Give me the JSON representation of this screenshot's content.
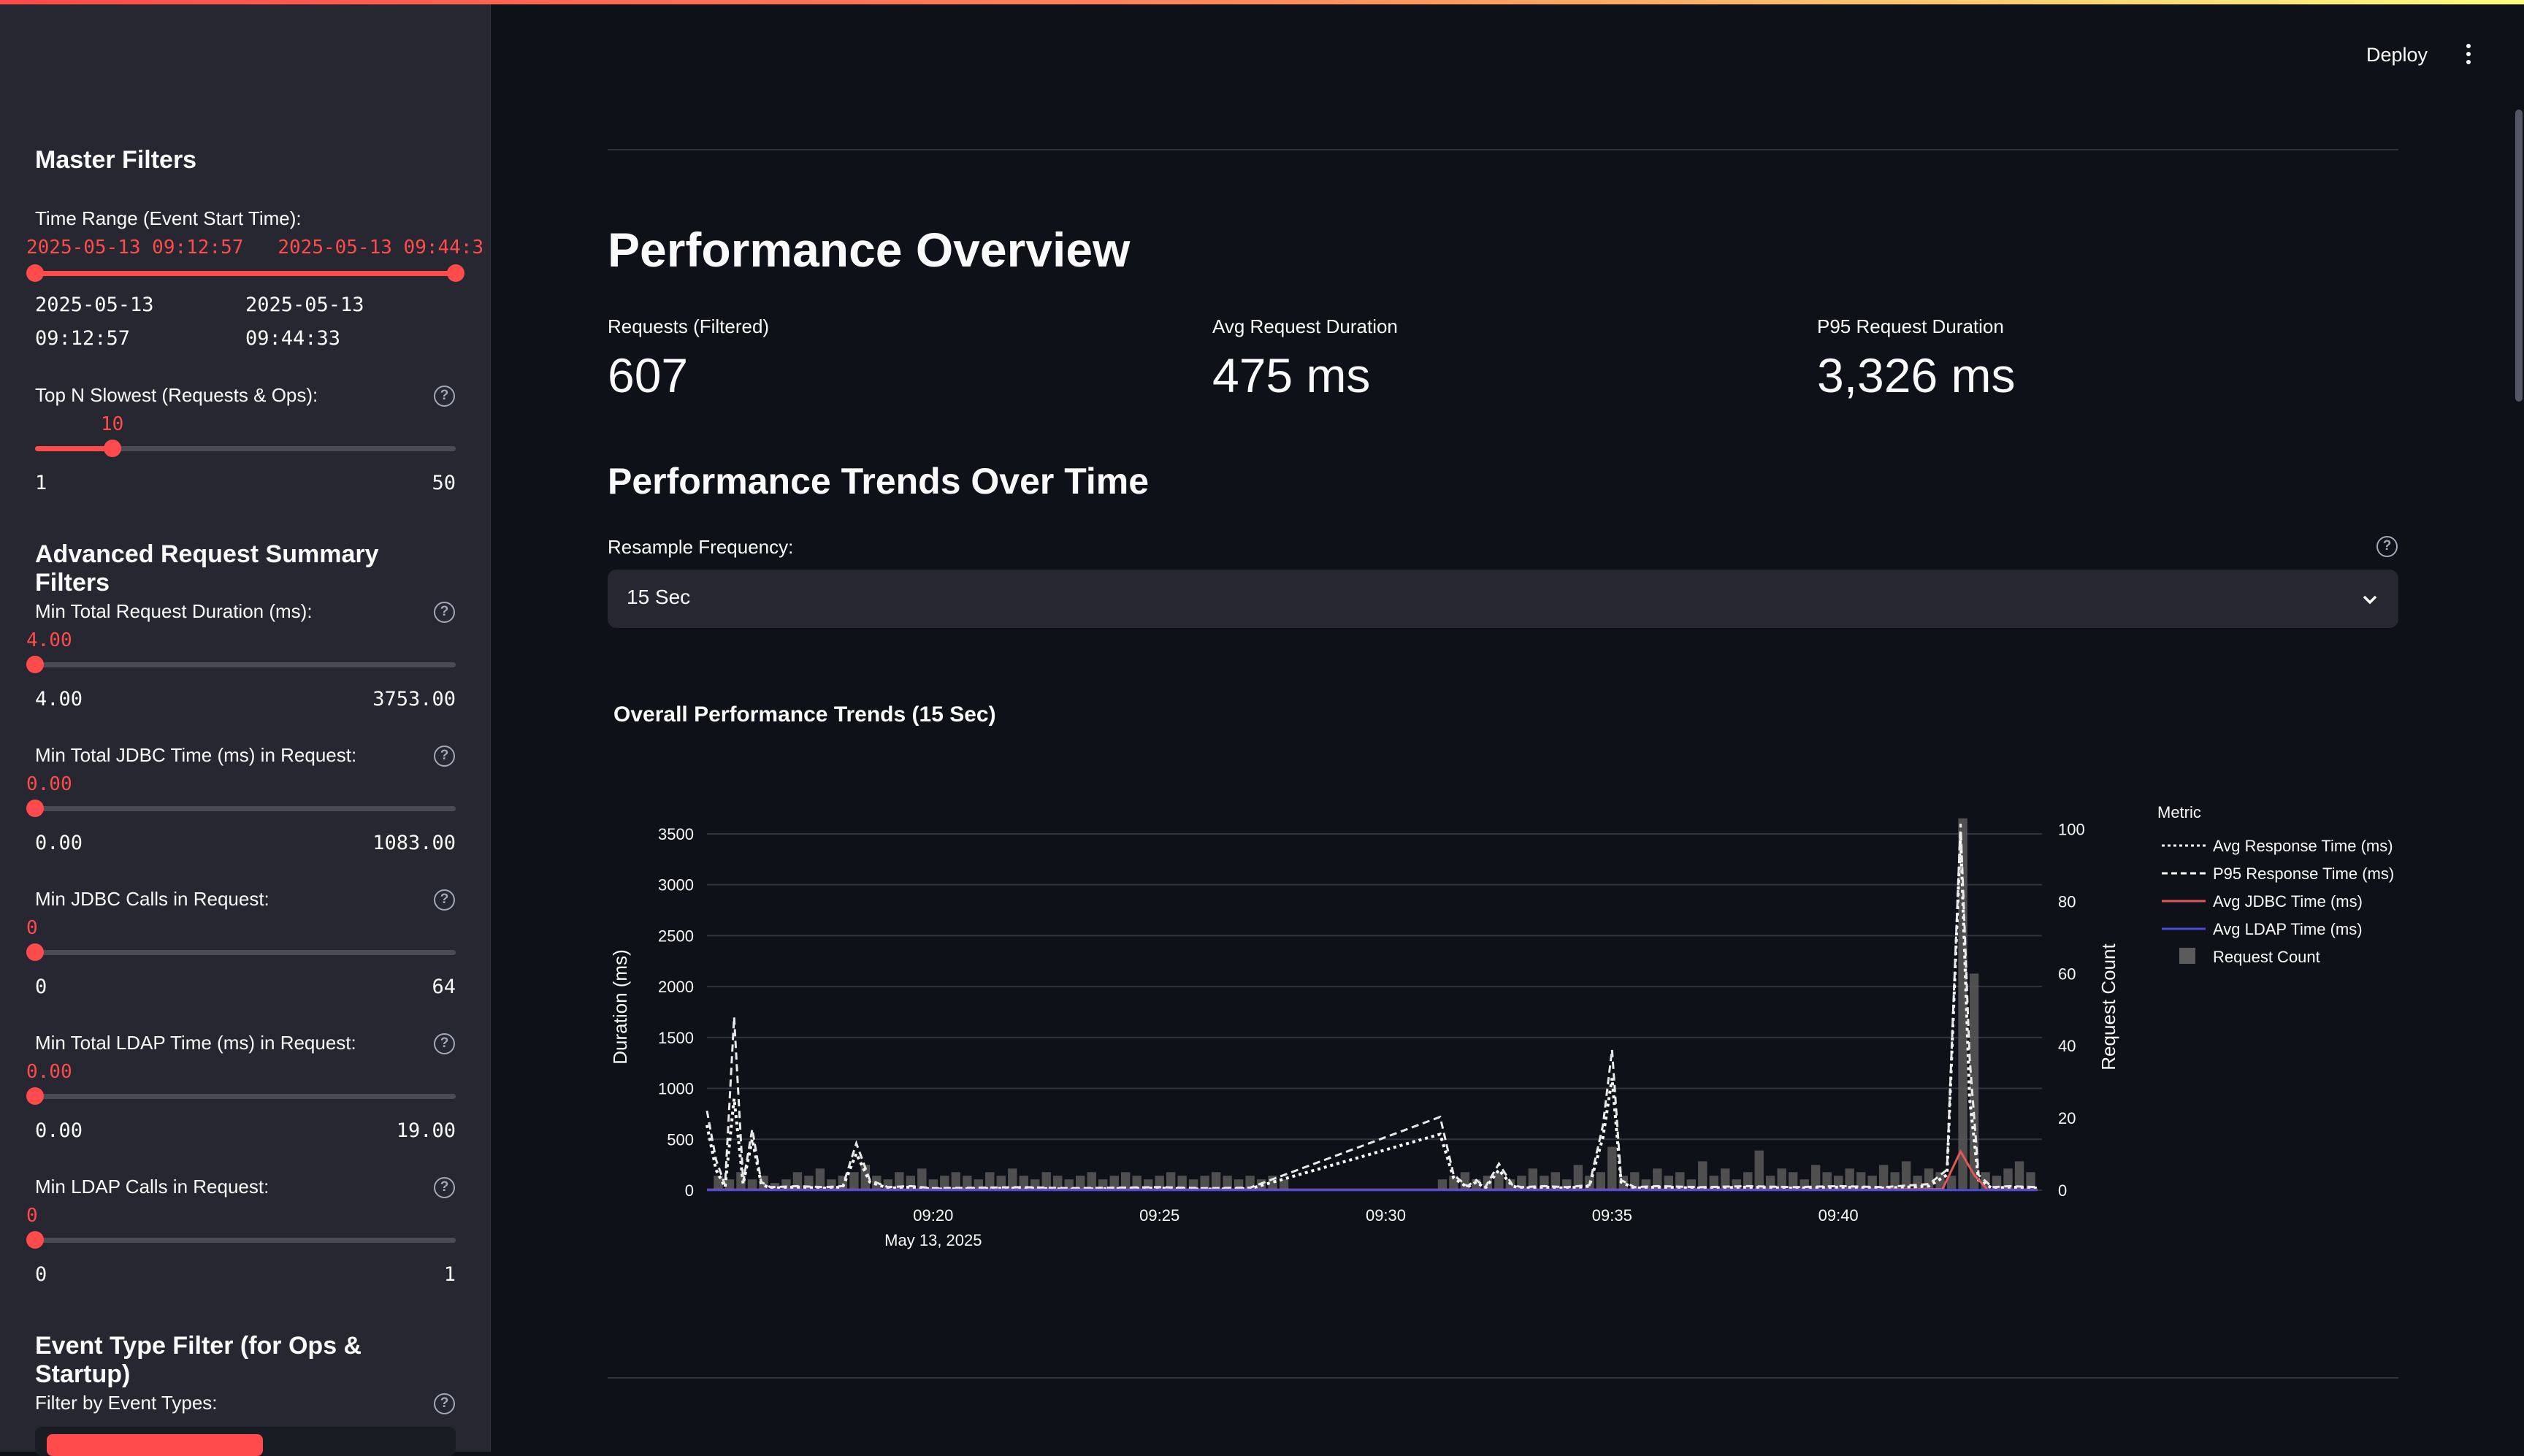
{
  "sidebar": {
    "master_filters_title": "Master Filters",
    "time_range": {
      "label": "Time Range (Event Start Time):",
      "value_display": "2025-05-13 09:12:57   2025-05-13 09:44:33",
      "min_date": "2025-05-13",
      "min_time": "09:12:57",
      "max_date": "2025-05-13",
      "max_time": "09:44:33"
    },
    "top_n": {
      "label": "Top N Slowest (Requests & Ops):",
      "value": "10",
      "min": "1",
      "max": "50",
      "fraction": 0.184
    },
    "advanced_title": "Advanced Request Summary Filters",
    "min_total_duration": {
      "label": "Min Total Request Duration (ms):",
      "value": "4.00",
      "min": "4.00",
      "max": "3753.00"
    },
    "min_jdbc_time": {
      "label": "Min Total JDBC Time (ms) in Request:",
      "value": "0.00",
      "min": "0.00",
      "max": "1083.00"
    },
    "min_jdbc_calls": {
      "label": "Min JDBC Calls in Request:",
      "value": "0",
      "min": "0",
      "max": "64"
    },
    "min_ldap_time": {
      "label": "Min Total LDAP Time (ms) in Request:",
      "value": "0.00",
      "min": "0.00",
      "max": "19.00"
    },
    "min_ldap_calls": {
      "label": "Min LDAP Calls in Request:",
      "value": "0",
      "min": "0",
      "max": "1"
    },
    "event_type_title": "Event Type Filter (for Ops & Startup)",
    "event_type_label": "Filter by Event Types:"
  },
  "header": {
    "deploy_label": "Deploy"
  },
  "main": {
    "title": "Performance Overview",
    "metrics": [
      {
        "label": "Requests (Filtered)",
        "value": "607"
      },
      {
        "label": "Avg Request Duration",
        "value": "475 ms"
      },
      {
        "label": "P95 Request Duration",
        "value": "3,326 ms"
      }
    ],
    "trends_title": "Performance Trends Over Time",
    "resample_label": "Resample Frequency:",
    "resample_value": "15 Sec"
  },
  "chart_data": {
    "type": "line",
    "title": "Overall Performance Trends (15 Sec)",
    "xlabel": "",
    "ylabel": "Duration (ms)",
    "y2label": "Request Count",
    "ylim": [
      0,
      3600
    ],
    "y2lim": [
      0,
      100
    ],
    "yticks": [
      "0",
      "500",
      "1000",
      "1500",
      "2000",
      "2500",
      "3000",
      "3500"
    ],
    "y2ticks": [
      "0",
      "20",
      "40",
      "60",
      "80",
      "100"
    ],
    "xticks": [
      "09:20",
      "09:25",
      "09:30",
      "09:35",
      "09:40"
    ],
    "xtick_sublabel": "May 13, 2025",
    "x_range_minutes": [
      15.0,
      44.5
    ],
    "legend_title": "Metric",
    "legend": [
      {
        "name": "Avg Response Time (ms)",
        "color": "#ffffff",
        "style": "dotted"
      },
      {
        "name": "P95 Response Time (ms)",
        "color": "#ffffff",
        "style": "dashed"
      },
      {
        "name": "Avg JDBC Time (ms)",
        "color": "#e45756",
        "style": "solid"
      },
      {
        "name": "Avg LDAP Time (ms)",
        "color": "#4c4cd8",
        "style": "solid"
      },
      {
        "name": "Request Count",
        "color": "#5a5a5a",
        "style": "bar"
      }
    ],
    "request_count": {
      "x": [
        15.25,
        15.5,
        15.75,
        16.0,
        16.25,
        16.5,
        16.75,
        17.0,
        17.25,
        17.5,
        17.75,
        18.0,
        18.25,
        18.5,
        18.75,
        19.0,
        19.25,
        19.5,
        19.75,
        20.0,
        20.25,
        20.5,
        20.75,
        21.0,
        21.25,
        21.5,
        21.75,
        22.0,
        22.25,
        22.5,
        22.75,
        23.0,
        23.25,
        23.5,
        23.75,
        24.0,
        24.25,
        24.5,
        24.75,
        25.0,
        25.25,
        25.5,
        25.75,
        26.0,
        26.25,
        26.5,
        26.75,
        27.0,
        27.25,
        27.5,
        27.75,
        31.25,
        31.5,
        31.75,
        32.0,
        32.25,
        32.5,
        32.75,
        33.0,
        33.25,
        33.5,
        33.75,
        34.0,
        34.25,
        34.5,
        34.75,
        35.0,
        35.25,
        35.5,
        35.75,
        36.0,
        36.25,
        36.5,
        36.75,
        37.0,
        37.25,
        37.5,
        37.75,
        38.0,
        38.25,
        38.5,
        38.75,
        39.0,
        39.25,
        39.5,
        39.75,
        40.0,
        40.25,
        40.5,
        40.75,
        41.0,
        41.25,
        41.5,
        41.75,
        42.0,
        42.25,
        42.5,
        42.75,
        43.0,
        43.25,
        43.5,
        43.75,
        44.0,
        44.25
      ],
      "values": [
        4,
        3,
        5,
        3,
        4,
        2,
        3,
        5,
        4,
        6,
        3,
        4,
        5,
        7,
        4,
        3,
        5,
        4,
        6,
        3,
        4,
        5,
        4,
        3,
        5,
        4,
        6,
        4,
        3,
        5,
        4,
        3,
        4,
        5,
        3,
        4,
        5,
        4,
        3,
        4,
        5,
        4,
        3,
        4,
        5,
        4,
        3,
        4,
        3,
        4,
        3,
        3,
        4,
        5,
        3,
        4,
        5,
        3,
        4,
        6,
        4,
        5,
        3,
        7,
        4,
        5,
        12,
        4,
        5,
        3,
        6,
        4,
        5,
        3,
        8,
        4,
        6,
        3,
        5,
        11,
        4,
        6,
        5,
        3,
        7,
        5,
        4,
        6,
        5,
        4,
        7,
        5,
        8,
        4,
        6,
        5,
        4,
        103,
        60,
        5,
        4,
        6,
        8,
        5,
        4,
        3
      ],
      "series_name": "Request Count"
    },
    "series": [
      {
        "name": "Avg Response Time (ms)",
        "x": [
          15.0,
          15.2,
          15.4,
          15.6,
          15.8,
          16.0,
          16.2,
          16.4,
          17.0,
          17.6,
          18.0,
          18.3,
          18.6,
          19.0,
          19.5,
          20.0,
          21.0,
          22.0,
          23.0,
          24.0,
          25.0,
          26.0,
          27.0,
          31.2,
          31.5,
          31.8,
          32.0,
          32.2,
          32.5,
          32.8,
          33.0,
          33.5,
          34.0,
          34.5,
          34.8,
          35.0,
          35.2,
          35.5,
          36.0,
          37.0,
          38.0,
          39.0,
          40.0,
          41.0,
          42.0,
          42.4,
          42.7,
          42.9,
          43.1,
          43.4,
          43.8,
          44.4
        ],
        "values": [
          640,
          200,
          30,
          900,
          60,
          500,
          60,
          20,
          30,
          20,
          30,
          360,
          80,
          20,
          30,
          10,
          15,
          20,
          10,
          15,
          20,
          10,
          15,
          550,
          120,
          30,
          80,
          20,
          200,
          40,
          20,
          30,
          20,
          40,
          520,
          1100,
          80,
          20,
          30,
          20,
          30,
          20,
          30,
          20,
          40,
          150,
          3500,
          900,
          100,
          20,
          30,
          20
        ]
      },
      {
        "name": "P95 Response Time (ms)",
        "x": [
          15.0,
          15.2,
          15.4,
          15.6,
          15.8,
          16.0,
          16.2,
          16.4,
          17.0,
          17.6,
          18.0,
          18.3,
          18.6,
          19.0,
          19.5,
          20.0,
          21.0,
          22.0,
          23.0,
          24.0,
          25.0,
          26.0,
          27.0,
          31.2,
          31.5,
          31.8,
          32.0,
          32.2,
          32.5,
          32.8,
          33.0,
          33.5,
          34.0,
          34.5,
          34.8,
          35.0,
          35.2,
          35.5,
          36.0,
          37.0,
          38.0,
          39.0,
          40.0,
          41.0,
          42.0,
          42.4,
          42.7,
          42.9,
          43.1,
          43.4,
          43.8,
          44.4
        ],
        "values": [
          780,
          300,
          50,
          1700,
          80,
          600,
          80,
          30,
          40,
          30,
          40,
          460,
          100,
          30,
          40,
          20,
          25,
          30,
          20,
          25,
          30,
          20,
          25,
          720,
          150,
          40,
          100,
          30,
          260,
          50,
          30,
          40,
          30,
          50,
          640,
          1380,
          100,
          30,
          40,
          30,
          40,
          30,
          40,
          30,
          60,
          200,
          3600,
          1300,
          150,
          30,
          40,
          30
        ]
      },
      {
        "name": "Avg JDBC Time (ms)",
        "x": [
          15.0,
          20.0,
          25.0,
          30.0,
          35.0,
          40.0,
          42.3,
          42.7,
          43.0,
          43.3,
          44.4
        ],
        "values": [
          5,
          5,
          5,
          5,
          5,
          5,
          10,
          380,
          150,
          5,
          5
        ]
      },
      {
        "name": "Avg LDAP Time (ms)",
        "x": [
          15.0,
          20.0,
          25.0,
          30.0,
          35.0,
          40.0,
          44.4
        ],
        "values": [
          2,
          2,
          2,
          2,
          2,
          2,
          2
        ]
      }
    ]
  }
}
